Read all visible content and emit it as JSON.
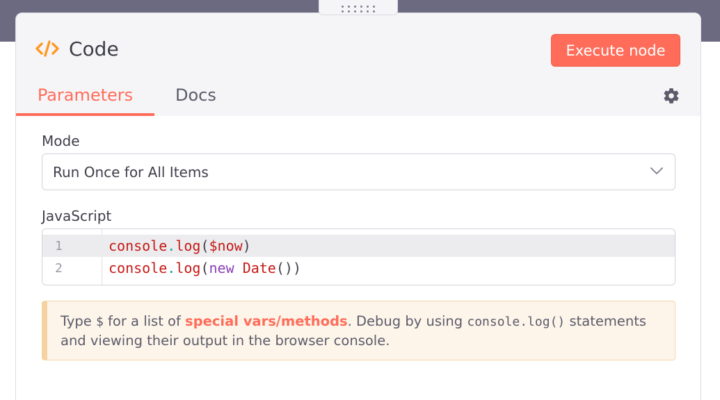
{
  "node": {
    "title": "Code",
    "icon": "code-brackets-icon",
    "execute_label": "Execute node"
  },
  "tabs": [
    {
      "label": "Parameters",
      "active": true
    },
    {
      "label": "Docs",
      "active": false
    }
  ],
  "settings_icon": "gear-icon",
  "mode": {
    "label": "Mode",
    "value": "Run Once for All Items"
  },
  "editor": {
    "label": "JavaScript",
    "lines": [
      {
        "number": "1",
        "tokens": [
          "console",
          ".",
          "log",
          "(",
          "$now",
          ")"
        ]
      },
      {
        "number": "2",
        "tokens": [
          "console",
          ".",
          "log",
          "(",
          "new",
          " ",
          "Date",
          "()",
          ")"
        ]
      }
    ]
  },
  "notice": {
    "part1": "Type ",
    "dollar": "$",
    "part2": " for a list of ",
    "link": "special vars/methods",
    "part3": ". Debug by using ",
    "code": "console.log()",
    "part4": " statements and viewing their output in the browser console."
  },
  "colors": {
    "accent": "#ff6d5a",
    "header_bg": "#f5f5f7",
    "notice_bg": "#fdf5ea",
    "notice_border": "#f5d3a0"
  }
}
